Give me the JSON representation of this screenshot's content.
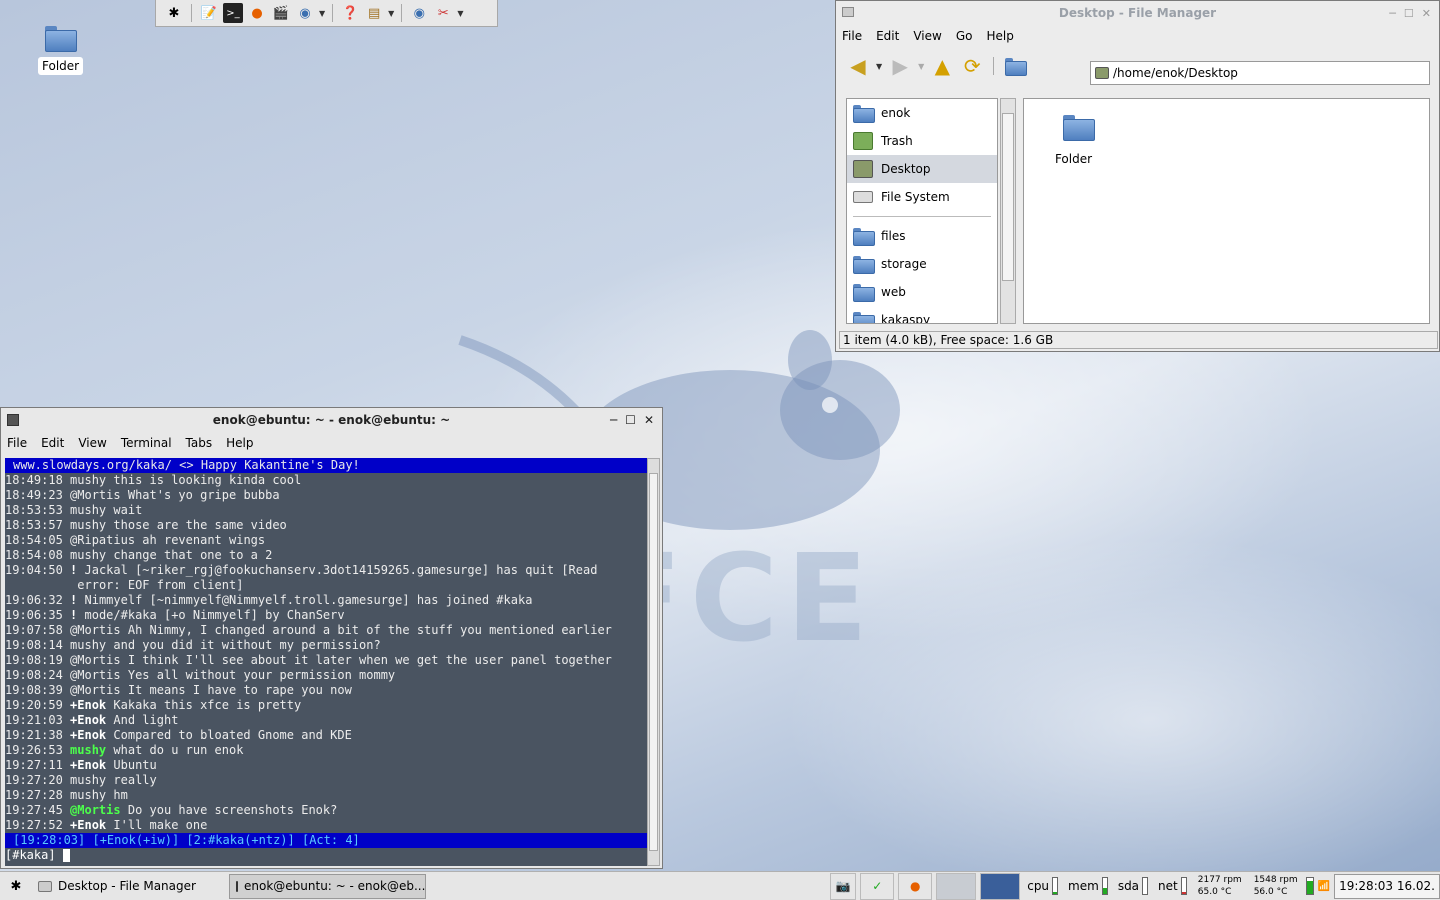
{
  "desktop": {
    "icon_label": "Folder"
  },
  "launcher": {
    "items": [
      "xfce-menu-icon",
      "text-editor-icon",
      "terminal-icon",
      "firefox-icon",
      "media-icon",
      "browser-icon",
      "help-icon",
      "notes-icon",
      "web-icon",
      "settings-icon"
    ]
  },
  "file_manager": {
    "title": "Desktop - File Manager",
    "menu": [
      "File",
      "Edit",
      "View",
      "Go",
      "Help"
    ],
    "location": "/home/enok/Desktop",
    "places": [
      "enok",
      "Trash",
      "Desktop",
      "File System"
    ],
    "bookmarks": [
      "files",
      "storage",
      "web",
      "kakaspy"
    ],
    "selected_place": "Desktop",
    "items": [
      "Folder"
    ],
    "status": "1 item (4.0 kB), Free space: 1.6 GB"
  },
  "terminal": {
    "title": "enok@ebuntu: ~ - enok@ebuntu: ~",
    "menu": [
      "File",
      "Edit",
      "View",
      "Terminal",
      "Tabs",
      "Help"
    ],
    "topic": "www.slowdays.org/kaka/ <> Happy Kakantine's Day!",
    "lines": [
      {
        "t": "18:49:18",
        "n": "mushy",
        "m": "this is looking kinda cool"
      },
      {
        "t": "18:49:23",
        "n": "@Mortis",
        "m": "What's yo gripe bubba"
      },
      {
        "t": "18:53:53",
        "n": "mushy",
        "m": "wait"
      },
      {
        "t": "18:53:57",
        "n": "mushy",
        "m": "those are the same video"
      },
      {
        "t": "18:54:05",
        "n": "@Ripatius",
        "m": "ah revenant wings"
      },
      {
        "t": "18:54:08",
        "n": "mushy",
        "m": "change that one to a 2"
      },
      {
        "t": "19:04:50",
        "n": "!",
        "m": "Jackal [~riker_rgj@fookuchanserv.3dot14159265.gamesurge] has quit [Read"
      },
      {
        "t": "",
        "n": "",
        "m": "error: EOF from client]"
      },
      {
        "t": "19:06:32",
        "n": "!",
        "m": "Nimmyelf [~nimmyelf@Nimmyelf.troll.gamesurge] has joined #kaka"
      },
      {
        "t": "19:06:35",
        "n": "!",
        "m": "mode/#kaka [+o Nimmyelf] by ChanServ"
      },
      {
        "t": "19:07:58",
        "n": "@Mortis",
        "m": "Ah Nimmy, I changed around a bit of the stuff you mentioned earlier"
      },
      {
        "t": "19:08:14",
        "n": "mushy",
        "m": "and you did it without my permission?"
      },
      {
        "t": "19:08:19",
        "n": "@Mortis",
        "m": "I think I'll see about it later when we get the user panel together"
      },
      {
        "t": "19:08:24",
        "n": "@Mortis",
        "m": "Yes all without your permission mommy"
      },
      {
        "t": "19:08:39",
        "n": "@Mortis",
        "m": "It means I have to rape you now"
      },
      {
        "t": "19:20:59",
        "n": "+Enok",
        "m": "Kakaka this xfce is pretty"
      },
      {
        "t": "19:21:03",
        "n": "+Enok",
        "m": "And light"
      },
      {
        "t": "19:21:38",
        "n": "+Enok",
        "m": "Compared to bloated Gnome and KDE"
      },
      {
        "t": "19:26:53",
        "n": "mushy",
        "m": "what do u run enok"
      },
      {
        "t": "19:27:11",
        "n": "+Enok",
        "m": "Ubuntu"
      },
      {
        "t": "19:27:20",
        "n": "mushy",
        "m": "really"
      },
      {
        "t": "19:27:28",
        "n": "mushy",
        "m": "hm"
      },
      {
        "t": "19:27:45",
        "n": "@Mortis",
        "m": "Do you have screenshots Enok?"
      },
      {
        "t": "19:27:52",
        "n": "+Enok",
        "m": "I'll make one"
      }
    ],
    "statusbar": "[19:28:03] [+Enok(+iw)] [2:#kaka(+ntz)] [Act: 4]",
    "prompt": "[#kaka]"
  },
  "taskbar": {
    "tasks": [
      "Desktop - File Manager",
      "enok@ebuntu: ~ - enok@eb..."
    ],
    "active_task": 1,
    "monitors": [
      "cpu",
      "mem",
      "sda",
      "net"
    ],
    "fan1": "2177 rpm",
    "temp1": "65.0 °C",
    "fan2": "1548 rpm",
    "temp2": "56.0 °C",
    "clock": "19:28:03 16.02."
  }
}
